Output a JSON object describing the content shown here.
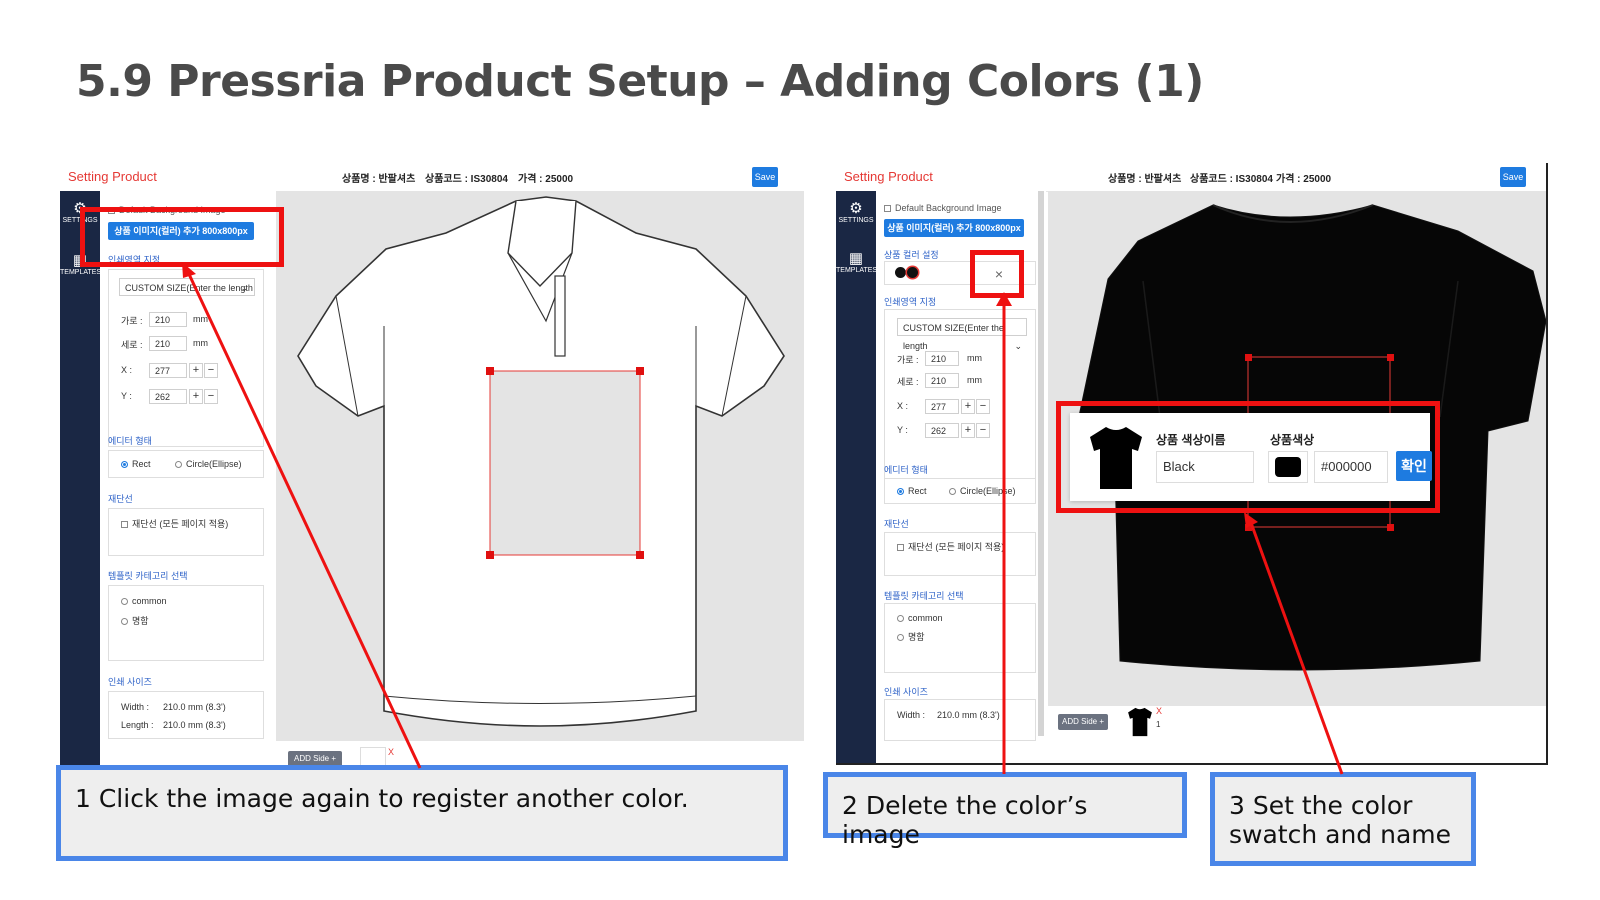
{
  "slide": {
    "title": "5.9 Pressria Product Setup – Adding Colors (1)"
  },
  "app": {
    "brand": "Setting Product",
    "product_name": "상품명 : 반팔셔츠",
    "product_code": "상품코드 : IS30804",
    "price": "가격 : 25000",
    "save_label": "Save",
    "nav": {
      "settings": "SETTINGS",
      "templates": "TEMPLATES"
    },
    "default_bg": "Default Background Image",
    "add_image_label": "상품 이미지(컬러) 추가 800x800px",
    "color_setting_label": "상품 컬러 설정",
    "print_area_label": "인쇄영역 지정",
    "size_select": "CUSTOM SIZE(Enter the length",
    "width_label": "가로 :",
    "height_label": "세로 :",
    "x_label": "X :",
    "y_label": "Y :",
    "width_value": "210",
    "height_value": "210",
    "x_value": "277",
    "y_value": "262",
    "unit": "mm",
    "editor_shape_label": "에디터 형태",
    "shape_rect": "Rect",
    "shape_circle": "Circle(Ellipse)",
    "cutline_label": "재단선",
    "cutline_option": "재단선 (모든 페이지 적용)",
    "template_cat_label": "템플릿 카테고리 선택",
    "template_common": "common",
    "template_card": "명함",
    "print_size_label": "인쇄 사이즈",
    "print_width_label": "Width :",
    "print_width_value": "210.0 mm (8.3')",
    "print_length_label": "Length :",
    "print_length_value": "210.0 mm (8.3')",
    "add_side_label": "ADD Side +",
    "thumb_remove": "X",
    "thumb_index": "1"
  },
  "color_dialog": {
    "name_label": "상품 색상이름",
    "name_value": "Black",
    "color_label": "상품색상",
    "hex_value": "#000000",
    "confirm_label": "확인",
    "swatch_color": "#000000"
  },
  "callouts": {
    "c1": "1 Click the image again to register another color.",
    "c2": "2 Delete the color’s image",
    "c3": "3 Set the color swatch and name"
  },
  "colors": {
    "accent_red": "#ee1111",
    "accent_blue": "#4a86e8",
    "nav_dark": "#1a2744",
    "button_blue": "#1e7be0"
  }
}
